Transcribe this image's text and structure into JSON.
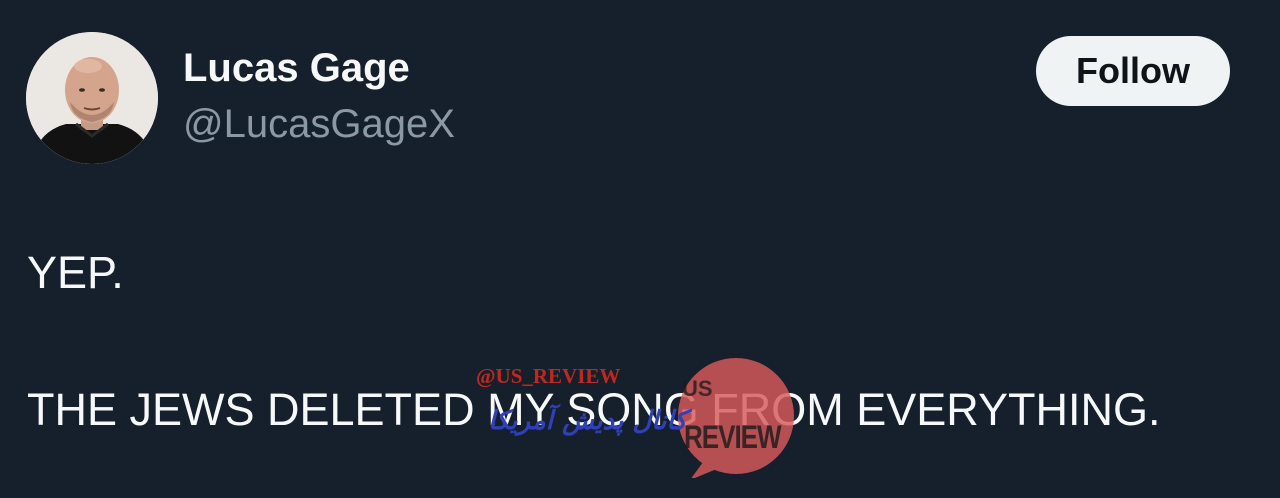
{
  "user": {
    "display_name": "Lucas Gage",
    "handle": "@LucasGageX"
  },
  "follow_button": {
    "label": "Follow"
  },
  "tweet": {
    "lines": [
      "YEP.",
      "THE JEWS DELETED MY SONG FROM EVERYTHING."
    ]
  },
  "watermark": {
    "handle": "@US_REVIEW",
    "persian_text": "کانال پدیش آمریکا",
    "badge_line_1": "US",
    "badge_line_2": "REVIEW"
  },
  "colors": {
    "background": "#16202c",
    "primary_text": "#f7f9f9",
    "secondary_text": "#8b98a5",
    "button_bg": "#eff3f4",
    "button_text": "#0f1419",
    "watermark_red": "#c0281f",
    "watermark_blue": "#2f40b8",
    "badge_red": "#d85a5a"
  },
  "icons": {
    "avatar": "profile-photo"
  }
}
